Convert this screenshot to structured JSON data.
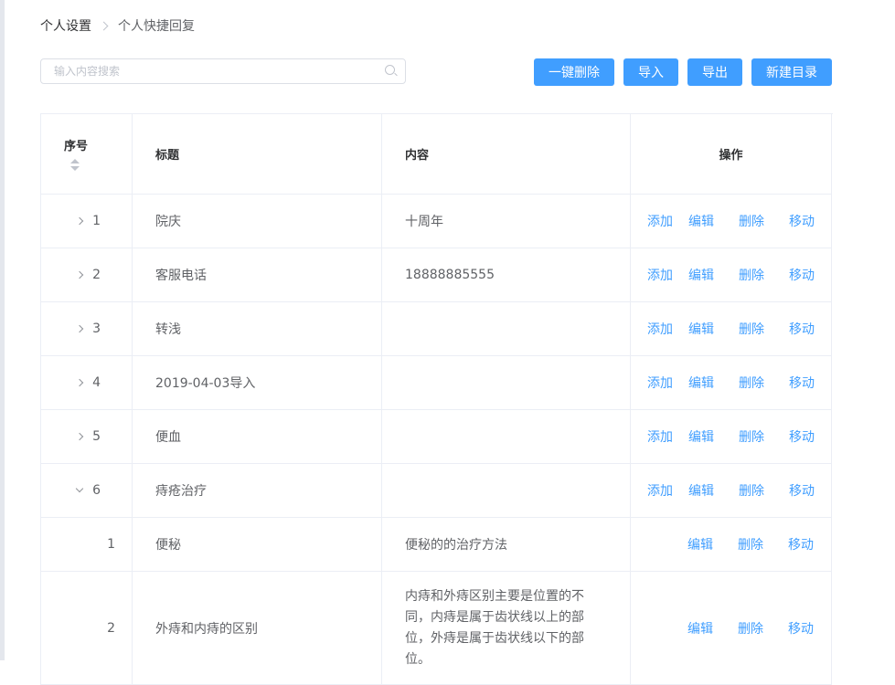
{
  "breadcrumb": {
    "parent": "个人设置",
    "current": "个人快捷回复"
  },
  "search": {
    "placeholder": "输入内容搜索"
  },
  "toolbar": {
    "delete_all": "一键删除",
    "import": "导入",
    "export": "导出",
    "new_folder": "新建目录"
  },
  "table": {
    "headers": {
      "index": "序号",
      "title": "标题",
      "content": "内容",
      "actions": "操作"
    },
    "actions": {
      "add": "添加",
      "edit": "编辑",
      "delete": "删除",
      "move": "移动"
    },
    "rows": [
      {
        "index": "1",
        "title": "院庆",
        "content": "十周年"
      },
      {
        "index": "2",
        "title": "客服电话",
        "content": "18888885555"
      },
      {
        "index": "3",
        "title": "转浅",
        "content": ""
      },
      {
        "index": "4",
        "title": "2019-04-03导入",
        "content": ""
      },
      {
        "index": "5",
        "title": "便血",
        "content": ""
      },
      {
        "index": "6",
        "title": "痔疮治疗",
        "content": ""
      }
    ],
    "children": [
      {
        "index": "1",
        "title": "便秘",
        "content": "便秘的的治疗方法"
      },
      {
        "index": "2",
        "title": "外痔和内痔的区别",
        "content": "内痔和外痔区别主要是位置的不同，内痔是属于齿状线以上的部位，外痔是属于齿状线以下的部位。"
      }
    ]
  },
  "colors": {
    "accent": "#409eff",
    "border": "#ebeef5",
    "text": "#606266"
  }
}
